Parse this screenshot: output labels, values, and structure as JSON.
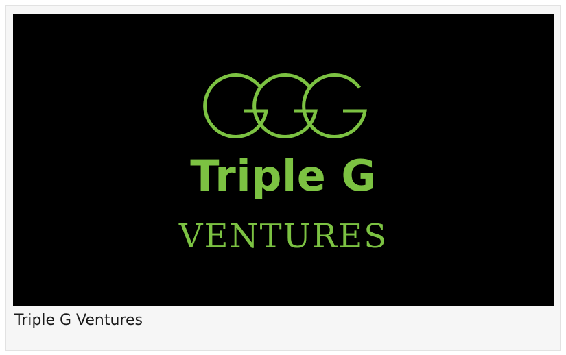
{
  "logo": {
    "word_top": "Triple G",
    "word_bottom": "VENTURES",
    "mark_icon": "three-interlocking-g-rings-icon",
    "accent_color": "#7cc242",
    "background_color": "#000000"
  },
  "caption": {
    "text": "Triple G Ventures"
  }
}
